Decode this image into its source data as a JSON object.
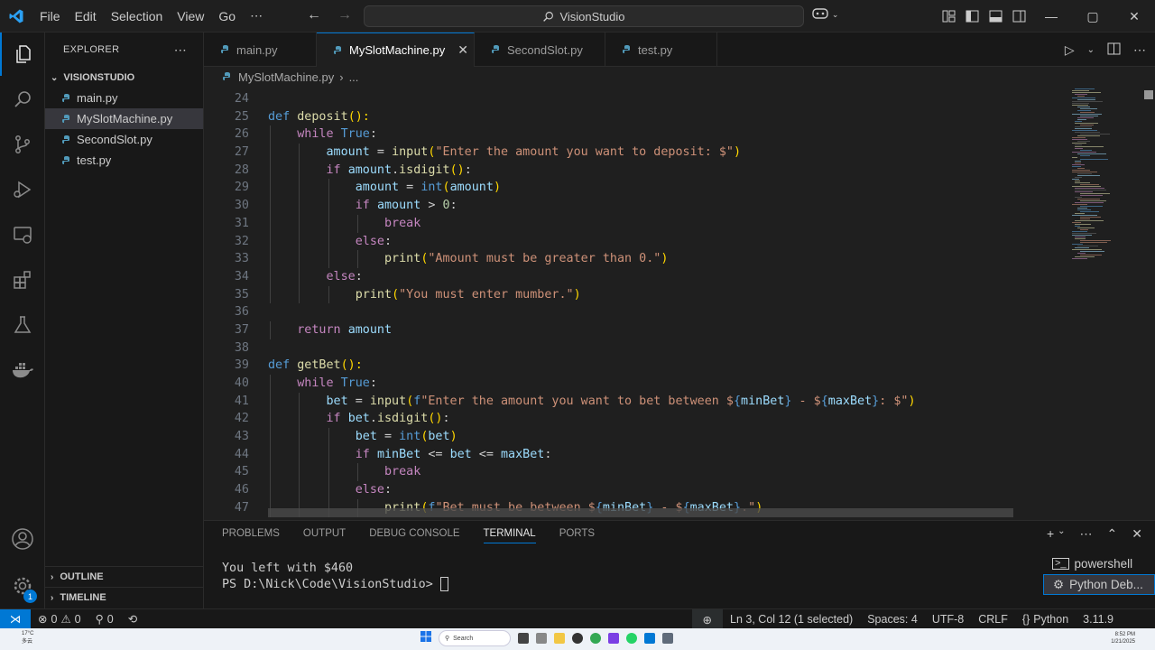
{
  "menu": [
    "File",
    "Edit",
    "Selection",
    "View",
    "Go",
    "⋯"
  ],
  "command_center": {
    "label": "VisionStudio"
  },
  "explorer": {
    "title": "EXPLORER",
    "more": "⋯",
    "folder": "VISIONSTUDIO",
    "files": [
      "main.py",
      "MySlotMachine.py",
      "SecondSlot.py",
      "test.py"
    ],
    "active_index": 1,
    "outline": "OUTLINE",
    "timeline": "TIMELINE"
  },
  "tabs": [
    {
      "label": "main.py"
    },
    {
      "label": "MySlotMachine.py",
      "close": "✕"
    },
    {
      "label": "SecondSlot.py"
    },
    {
      "label": "test.py"
    }
  ],
  "breadcrumb": {
    "file": "MySlotMachine.py",
    "sep": "›",
    "rest": "..."
  },
  "editor": {
    "line_numbers": [
      "24",
      "25",
      "26",
      "27",
      "28",
      "29",
      "30",
      "31",
      "32",
      "33",
      "34",
      "35",
      "36",
      "37",
      "38",
      "39",
      "40",
      "41",
      "42",
      "43",
      "44",
      "45",
      "46",
      "47"
    ],
    "lines": [
      [],
      [
        {
          "t": "def ",
          "c": "kw"
        },
        {
          "t": "deposit",
          "c": "fn"
        },
        {
          "t": "():",
          "c": "br1"
        }
      ],
      [
        {
          "t": "    "
        },
        {
          "t": "while ",
          "c": "ctrl"
        },
        {
          "t": "True",
          "c": "kw"
        },
        {
          "t": ":"
        }
      ],
      [
        {
          "t": "        "
        },
        {
          "t": "amount",
          "c": "var"
        },
        {
          "t": " = "
        },
        {
          "t": "input",
          "c": "fn"
        },
        {
          "t": "(",
          "c": "br1"
        },
        {
          "t": "\"Enter the amount you want to deposit: $\"",
          "c": "str"
        },
        {
          "t": ")",
          "c": "br1"
        }
      ],
      [
        {
          "t": "        "
        },
        {
          "t": "if ",
          "c": "ctrl"
        },
        {
          "t": "amount",
          "c": "var"
        },
        {
          "t": "."
        },
        {
          "t": "isdigit",
          "c": "fn"
        },
        {
          "t": "()",
          "c": "br1"
        },
        {
          "t": ":"
        }
      ],
      [
        {
          "t": "            "
        },
        {
          "t": "amount",
          "c": "var"
        },
        {
          "t": " = "
        },
        {
          "t": "int",
          "c": "kw"
        },
        {
          "t": "(",
          "c": "br1"
        },
        {
          "t": "amount",
          "c": "var"
        },
        {
          "t": ")",
          "c": "br1"
        }
      ],
      [
        {
          "t": "            "
        },
        {
          "t": "if ",
          "c": "ctrl"
        },
        {
          "t": "amount",
          "c": "var"
        },
        {
          "t": " > "
        },
        {
          "t": "0",
          "c": "num"
        },
        {
          "t": ":"
        }
      ],
      [
        {
          "t": "                "
        },
        {
          "t": "break",
          "c": "ctrl"
        }
      ],
      [
        {
          "t": "            "
        },
        {
          "t": "else",
          "c": "ctrl"
        },
        {
          "t": ":"
        }
      ],
      [
        {
          "t": "                "
        },
        {
          "t": "print",
          "c": "fn"
        },
        {
          "t": "(",
          "c": "br1"
        },
        {
          "t": "\"Amount must be greater than 0.\"",
          "c": "str"
        },
        {
          "t": ")",
          "c": "br1"
        }
      ],
      [
        {
          "t": "        "
        },
        {
          "t": "else",
          "c": "ctrl"
        },
        {
          "t": ":"
        }
      ],
      [
        {
          "t": "            "
        },
        {
          "t": "print",
          "c": "fn"
        },
        {
          "t": "(",
          "c": "br1"
        },
        {
          "t": "\"You must enter mumber.\"",
          "c": "str"
        },
        {
          "t": ")",
          "c": "br1"
        }
      ],
      [],
      [
        {
          "t": "    "
        },
        {
          "t": "return ",
          "c": "ctrl"
        },
        {
          "t": "amount",
          "c": "var"
        }
      ],
      [],
      [
        {
          "t": "def ",
          "c": "kw"
        },
        {
          "t": "getBet",
          "c": "fn"
        },
        {
          "t": "():",
          "c": "br1"
        }
      ],
      [
        {
          "t": "    "
        },
        {
          "t": "while ",
          "c": "ctrl"
        },
        {
          "t": "True",
          "c": "kw"
        },
        {
          "t": ":"
        }
      ],
      [
        {
          "t": "        "
        },
        {
          "t": "bet",
          "c": "var"
        },
        {
          "t": " = "
        },
        {
          "t": "input",
          "c": "fn"
        },
        {
          "t": "(",
          "c": "br1"
        },
        {
          "t": "f",
          "c": "kw"
        },
        {
          "t": "\"Enter the amount you want to bet between $",
          "c": "str"
        },
        {
          "t": "{",
          "c": "kw"
        },
        {
          "t": "minBet",
          "c": "var"
        },
        {
          "t": "}",
          "c": "kw"
        },
        {
          "t": " - $",
          "c": "str"
        },
        {
          "t": "{",
          "c": "kw"
        },
        {
          "t": "maxBet",
          "c": "var"
        },
        {
          "t": "}",
          "c": "kw"
        },
        {
          "t": ": $\"",
          "c": "str"
        },
        {
          "t": ")",
          "c": "br1"
        }
      ],
      [
        {
          "t": "        "
        },
        {
          "t": "if ",
          "c": "ctrl"
        },
        {
          "t": "bet",
          "c": "var"
        },
        {
          "t": "."
        },
        {
          "t": "isdigit",
          "c": "fn"
        },
        {
          "t": "()",
          "c": "br1"
        },
        {
          "t": ":"
        }
      ],
      [
        {
          "t": "            "
        },
        {
          "t": "bet",
          "c": "var"
        },
        {
          "t": " = "
        },
        {
          "t": "int",
          "c": "kw"
        },
        {
          "t": "(",
          "c": "br1"
        },
        {
          "t": "bet",
          "c": "var"
        },
        {
          "t": ")",
          "c": "br1"
        }
      ],
      [
        {
          "t": "            "
        },
        {
          "t": "if ",
          "c": "ctrl"
        },
        {
          "t": "minBet",
          "c": "var"
        },
        {
          "t": " <= "
        },
        {
          "t": "bet",
          "c": "var"
        },
        {
          "t": " <= "
        },
        {
          "t": "maxBet",
          "c": "var"
        },
        {
          "t": ":"
        }
      ],
      [
        {
          "t": "                "
        },
        {
          "t": "break",
          "c": "ctrl"
        }
      ],
      [
        {
          "t": "            "
        },
        {
          "t": "else",
          "c": "ctrl"
        },
        {
          "t": ":"
        }
      ],
      [
        {
          "t": "                "
        },
        {
          "t": "print",
          "c": "fn"
        },
        {
          "t": "(",
          "c": "br1"
        },
        {
          "t": "f",
          "c": "kw"
        },
        {
          "t": "\"Bet must be between $",
          "c": "str"
        },
        {
          "t": "{",
          "c": "kw"
        },
        {
          "t": "minBet",
          "c": "var"
        },
        {
          "t": "}",
          "c": "kw"
        },
        {
          "t": " - $",
          "c": "str"
        },
        {
          "t": "{",
          "c": "kw"
        },
        {
          "t": "maxBet",
          "c": "var"
        },
        {
          "t": "}",
          "c": "kw"
        },
        {
          "t": ".\"",
          "c": "str"
        },
        {
          "t": ")",
          "c": "br1"
        }
      ]
    ]
  },
  "panel": {
    "tabs": [
      "PROBLEMS",
      "OUTPUT",
      "DEBUG CONSOLE",
      "TERMINAL",
      "PORTS"
    ],
    "active_tab": 3,
    "terminal_lines": [
      "You left with $460",
      "PS D:\\Nick\\Code\\VisionStudio> "
    ],
    "terminals": [
      "powershell",
      "Python Deb..."
    ],
    "active_terminal": 1
  },
  "status": {
    "errors": "0",
    "warnings": "0",
    "ports": "0",
    "cursor": "Ln 3, Col 12 (1 selected)",
    "spaces": "Spaces: 4",
    "encoding": "UTF-8",
    "eol": "CRLF",
    "language": "Python",
    "interpreter": "3.11.9"
  },
  "notifications_badge": "1",
  "taskbar": {
    "temp": "17°C",
    "weather": "多云",
    "search": "Search",
    "time": "8:52 PM",
    "date": "1/21/2025"
  },
  "colors": {
    "accent": "#0078d4",
    "editor_bg": "#1f1f1f",
    "sidebar_bg": "#181818"
  }
}
